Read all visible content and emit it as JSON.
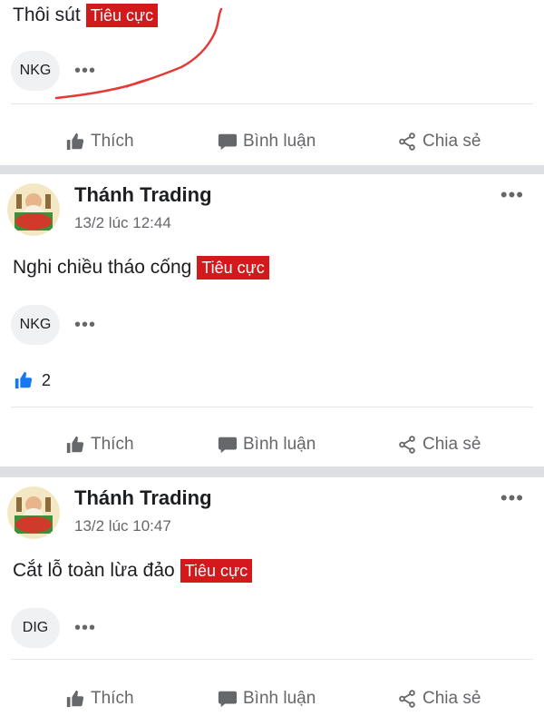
{
  "posts": [
    {
      "text": "Thôi sút",
      "tag": "Tiêu cực",
      "ticker": "NKG",
      "more": "•••"
    },
    {
      "author": "Thánh Trading",
      "time": "13/2 lúc 12:44",
      "text": "Nghi chiều tháo cống",
      "tag": "Tiêu cực",
      "ticker": "NKG",
      "more": "•••",
      "like_count": "2"
    },
    {
      "author": "Thánh Trading",
      "time": "13/2 lúc 10:47",
      "text": "Cắt lỗ toàn lừa đảo",
      "tag": "Tiêu cực",
      "ticker": "DIG",
      "more": "•••"
    }
  ],
  "actions": {
    "like": "Thích",
    "comment": "Bình luận",
    "share": "Chia sẻ"
  },
  "icons": {
    "like": "thumbs-up-icon",
    "comment": "comment-icon",
    "share": "share-icon"
  },
  "colors": {
    "tag_bg": "#d4191c",
    "accent_blue": "#1877f2",
    "scribble": "#e53935"
  }
}
